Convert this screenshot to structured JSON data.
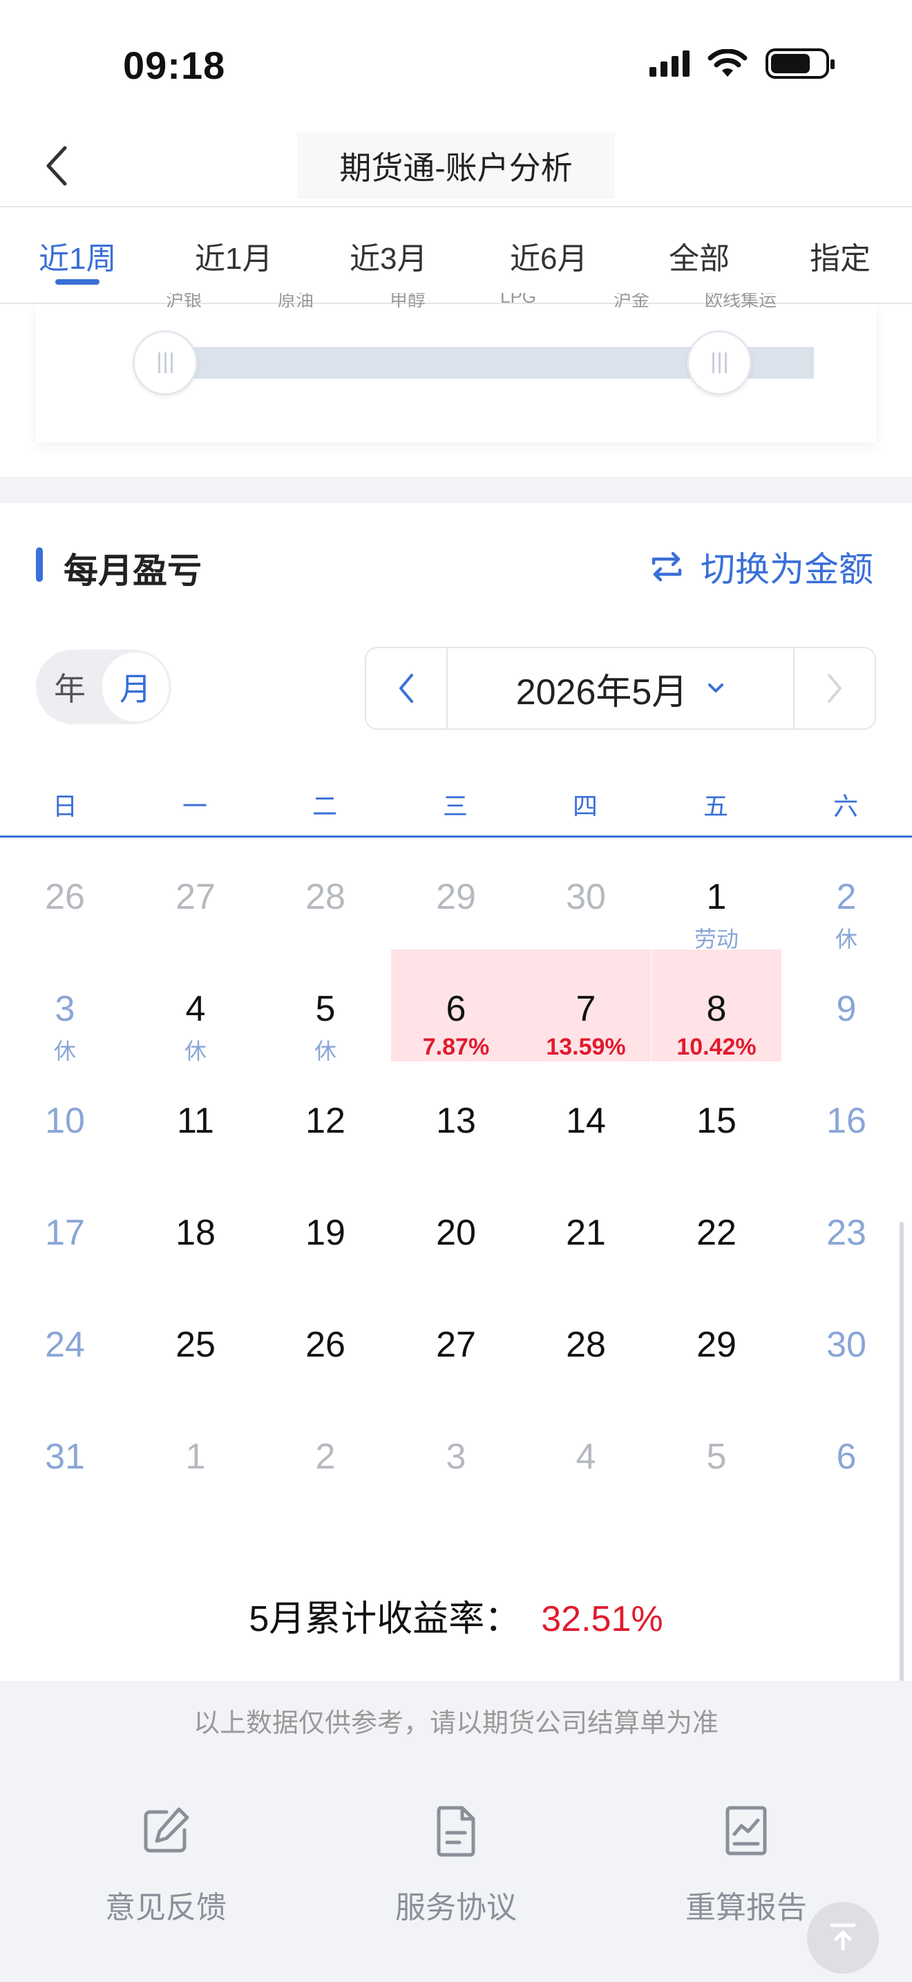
{
  "status_bar": {
    "time": "09:18"
  },
  "navbar": {
    "title": "期货通-账户分析"
  },
  "period_tabs": [
    {
      "label": "近1周",
      "active": true
    },
    {
      "label": "近1月"
    },
    {
      "label": "近3月"
    },
    {
      "label": "近6月"
    },
    {
      "label": "全部"
    },
    {
      "label": "指定"
    }
  ],
  "slider": {
    "labels": [
      "沪银",
      "原油",
      "甲醇",
      "LPG",
      "沪金",
      "欧线集运"
    ]
  },
  "pnl": {
    "title": "每月盈亏",
    "switch_label": "切换为金额",
    "toggle": {
      "year": "年",
      "month": "月"
    },
    "month_picker": "2026年5月"
  },
  "weekdays": [
    "日",
    "一",
    "二",
    "三",
    "四",
    "五",
    "六"
  ],
  "calendar": [
    [
      {
        "d": "26",
        "t": "other"
      },
      {
        "d": "27",
        "t": "other"
      },
      {
        "d": "28",
        "t": "other"
      },
      {
        "d": "29",
        "t": "other"
      },
      {
        "d": "30",
        "t": "other"
      },
      {
        "d": "1",
        "t": "cur",
        "s": "劳动"
      },
      {
        "d": "2",
        "t": "weekend",
        "s": "休"
      }
    ],
    [
      {
        "d": "3",
        "t": "weekend",
        "s": "休"
      },
      {
        "d": "4",
        "t": "cur",
        "s": "休"
      },
      {
        "d": "5",
        "t": "cur",
        "s": "休"
      },
      {
        "d": "6",
        "t": "hl",
        "s": "7.87%"
      },
      {
        "d": "7",
        "t": "hl",
        "s": "13.59%"
      },
      {
        "d": "8",
        "t": "hl",
        "s": "10.42%"
      },
      {
        "d": "9",
        "t": "weekend"
      }
    ],
    [
      {
        "d": "10",
        "t": "weekend"
      },
      {
        "d": "11",
        "t": "cur"
      },
      {
        "d": "12",
        "t": "cur"
      },
      {
        "d": "13",
        "t": "cur"
      },
      {
        "d": "14",
        "t": "cur"
      },
      {
        "d": "15",
        "t": "cur"
      },
      {
        "d": "16",
        "t": "weekend"
      }
    ],
    [
      {
        "d": "17",
        "t": "weekend"
      },
      {
        "d": "18",
        "t": "cur"
      },
      {
        "d": "19",
        "t": "cur"
      },
      {
        "d": "20",
        "t": "cur"
      },
      {
        "d": "21",
        "t": "cur"
      },
      {
        "d": "22",
        "t": "cur"
      },
      {
        "d": "23",
        "t": "weekend"
      }
    ],
    [
      {
        "d": "24",
        "t": "weekend"
      },
      {
        "d": "25",
        "t": "cur"
      },
      {
        "d": "26",
        "t": "cur"
      },
      {
        "d": "27",
        "t": "cur"
      },
      {
        "d": "28",
        "t": "cur"
      },
      {
        "d": "29",
        "t": "cur"
      },
      {
        "d": "30",
        "t": "weekend"
      }
    ],
    [
      {
        "d": "31",
        "t": "weekend"
      },
      {
        "d": "1",
        "t": "other"
      },
      {
        "d": "2",
        "t": "other"
      },
      {
        "d": "3",
        "t": "other"
      },
      {
        "d": "4",
        "t": "other"
      },
      {
        "d": "5",
        "t": "other"
      },
      {
        "d": "6",
        "t": "weekend"
      }
    ]
  ],
  "summary": {
    "label": "5月累计收益率：",
    "value": "32.51%"
  },
  "footer": {
    "disclaimer": "以上数据仅供参考，请以期货公司结算单为准",
    "buttons": [
      "意见反馈",
      "服务协议",
      "重算报告"
    ]
  },
  "colors": {
    "accent": "#3a6fd8",
    "profit": "#e01b2e",
    "highlight": "#ffe3e6"
  }
}
